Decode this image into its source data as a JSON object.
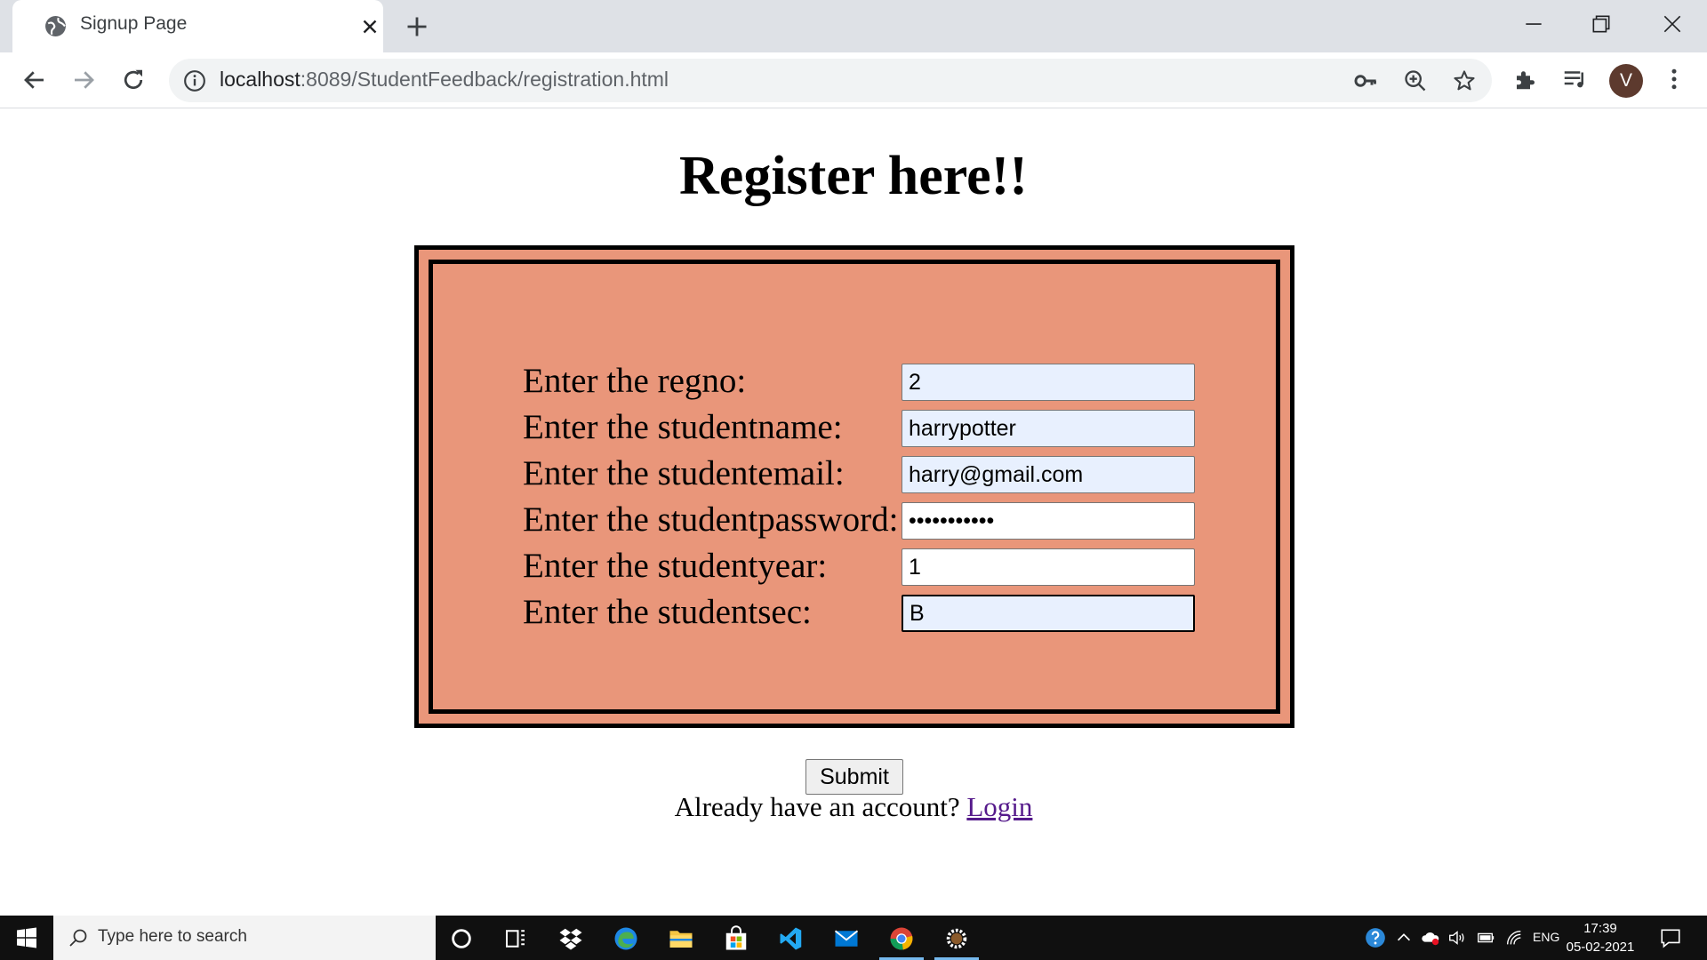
{
  "browser": {
    "tab_title": "Signup Page",
    "url_host": "localhost",
    "url_rest": ":8089/StudentFeedback/registration.html",
    "profile_initial": "V"
  },
  "page": {
    "title": "Register here!!",
    "form": {
      "regno_label": "Enter the regno:",
      "regno_value": "2",
      "name_label": "Enter the studentname:",
      "name_value": "harrypotter",
      "email_label": "Enter the studentemail:",
      "email_value": "harry@gmail.com",
      "password_label": "Enter the studentpassword:",
      "password_value": "•••••••••••",
      "year_label": "Enter the studentyear:",
      "year_value": "1",
      "sec_label": "Enter the studentsec:",
      "sec_value": "B"
    },
    "submit_label": "Submit",
    "login_prompt": "Already have an account? ",
    "login_link": "Login"
  },
  "taskbar": {
    "search_placeholder": "Type here to search",
    "language": "ENG",
    "time": "17:39",
    "date": "05-02-2021"
  },
  "colors": {
    "form_background": "#e9967a",
    "link": "#551a8b",
    "autofill": "#e8f0fe"
  }
}
